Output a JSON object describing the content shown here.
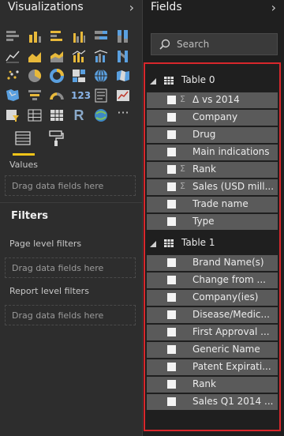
{
  "visualizations": {
    "title": "Visualizations",
    "collapse_icon": "chevron-right-icon",
    "icons": [
      "stacked-bar-icon",
      "stacked-column-icon",
      "clustered-bar-icon",
      "clustered-column-icon",
      "100-bar-icon",
      "100-column-icon",
      "line-chart-icon",
      "area-chart-icon",
      "stacked-area-icon",
      "line-column-icon",
      "line-cluster-icon",
      "ribbon-icon",
      "scatter-icon",
      "pie-icon",
      "donut-icon",
      "treemap-icon",
      "globe-map-icon",
      "filled-map-icon",
      "shape-map-icon",
      "funnel-icon",
      "gauge-icon",
      "card-icon",
      "multirow-card-icon",
      "kpi-icon",
      "slicer-icon",
      "table-icon",
      "matrix-icon",
      "r-visual-icon",
      "arcgis-icon",
      "more-icon"
    ],
    "card_text": "123",
    "r_text": "R",
    "more_text": "···",
    "values_label": "Values",
    "drop_placeholder": "Drag data fields here"
  },
  "filters": {
    "title": "Filters",
    "page_level_label": "Page level filters",
    "page_drop": "Drag data fields here",
    "report_level_label": "Report level filters",
    "report_drop": "Drag data fields here"
  },
  "fields": {
    "title": "Fields",
    "collapse_icon": "chevron-right-icon",
    "search_placeholder": "Search",
    "tables": [
      {
        "name": "Table 0",
        "fields": [
          {
            "label": "Δ vs 2014",
            "sigma": "Σ"
          },
          {
            "label": "Company",
            "sigma": ""
          },
          {
            "label": "Drug",
            "sigma": ""
          },
          {
            "label": "Main indications",
            "sigma": ""
          },
          {
            "label": "Rank",
            "sigma": "Σ"
          },
          {
            "label": "Sales (USD mill...",
            "sigma": "Σ"
          },
          {
            "label": "Trade name",
            "sigma": ""
          },
          {
            "label": "Type",
            "sigma": ""
          }
        ]
      },
      {
        "name": "Table 1",
        "fields": [
          {
            "label": "Brand Name(s)",
            "sigma": ""
          },
          {
            "label": "Change from ...",
            "sigma": ""
          },
          {
            "label": "Company(ies)",
            "sigma": ""
          },
          {
            "label": "Disease/Medic...",
            "sigma": ""
          },
          {
            "label": "First Approval ...",
            "sigma": ""
          },
          {
            "label": "Generic Name",
            "sigma": ""
          },
          {
            "label": "Patent Expirati...",
            "sigma": ""
          },
          {
            "label": "Rank",
            "sigma": ""
          },
          {
            "label": "Sales Q1 2014 ...",
            "sigma": ""
          }
        ]
      }
    ]
  },
  "colors": {
    "highlight_border": "#d8272c",
    "tab_underline": "#f0c419"
  }
}
